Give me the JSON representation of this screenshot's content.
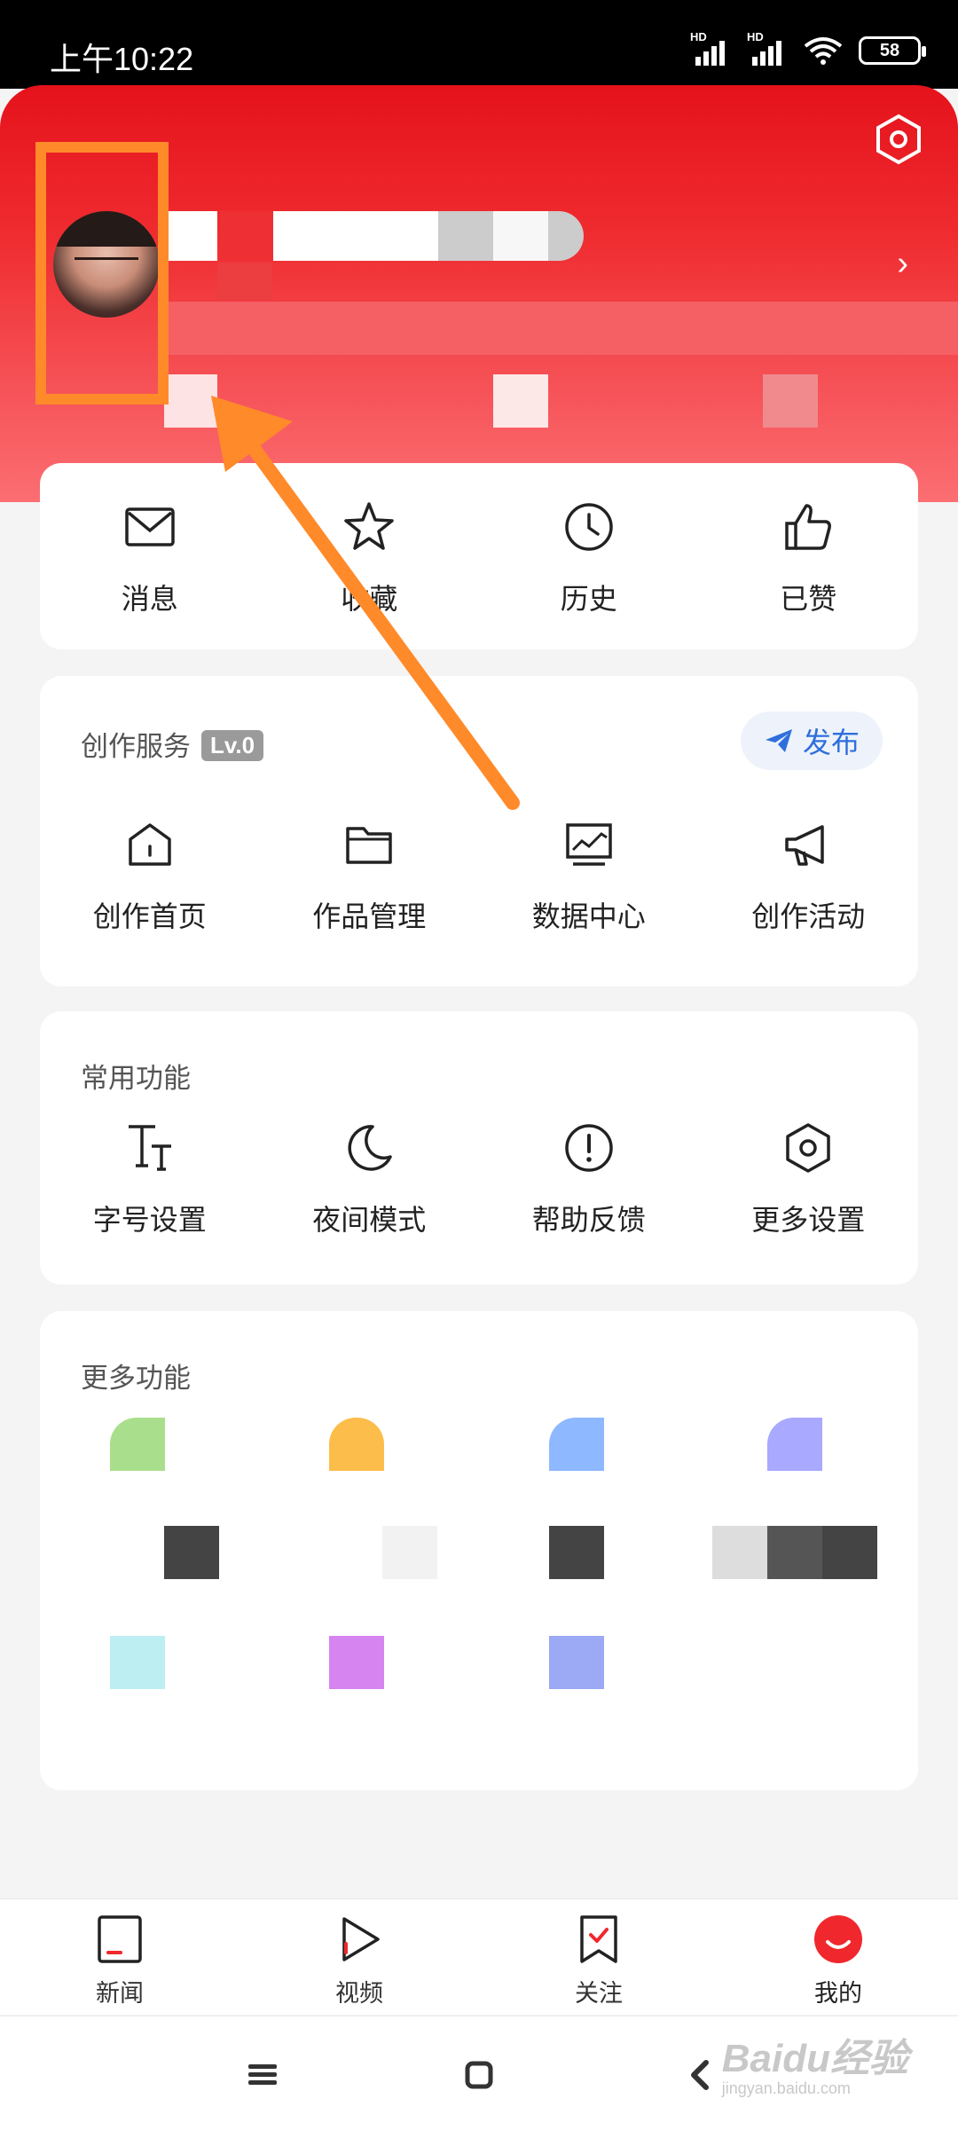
{
  "status_bar": {
    "time": "上午10:22",
    "hd1": "HD",
    "hd2": "HD",
    "battery": "58"
  },
  "header": {
    "settings_icon": "hexagon-settings-icon",
    "user_name": "",
    "chevron_icon": "chevron-right-icon"
  },
  "quick_actions": [
    {
      "label": "消息",
      "icon": "envelope-icon"
    },
    {
      "label": "收藏",
      "icon": "star-icon"
    },
    {
      "label": "历史",
      "icon": "clock-icon"
    },
    {
      "label": "已赞",
      "icon": "thumbs-up-icon"
    }
  ],
  "creation": {
    "title": "创作服务",
    "level": "Lv.0",
    "publish_label": "发布",
    "items": [
      {
        "label": "创作首页",
        "icon": "home-icon"
      },
      {
        "label": "作品管理",
        "icon": "folder-icon"
      },
      {
        "label": "数据中心",
        "icon": "chart-monitor-icon"
      },
      {
        "label": "创作活动",
        "icon": "megaphone-icon"
      }
    ]
  },
  "common": {
    "title": "常用功能",
    "items": [
      {
        "label": "字号设置",
        "icon": "font-size-icon"
      },
      {
        "label": "夜间模式",
        "icon": "moon-icon"
      },
      {
        "label": "帮助反馈",
        "icon": "exclamation-circle-icon"
      },
      {
        "label": "更多设置",
        "icon": "hexagon-settings-icon"
      }
    ]
  },
  "more": {
    "title": "更多功能"
  },
  "bottom_nav": [
    {
      "label": "新闻",
      "icon": "news-icon"
    },
    {
      "label": "视频",
      "icon": "play-icon"
    },
    {
      "label": "关注",
      "icon": "bookmark-check-icon"
    },
    {
      "label": "我的",
      "icon": "avatar-smile-icon"
    }
  ],
  "watermark": {
    "text": "Baidu经验",
    "sub": "jingyan.baidu.com"
  },
  "colors": {
    "header_red": "#e5121c",
    "accent_orange": "#ff8a2a",
    "publish_blue": "#2f6fdc",
    "active_red": "#f0282d"
  }
}
